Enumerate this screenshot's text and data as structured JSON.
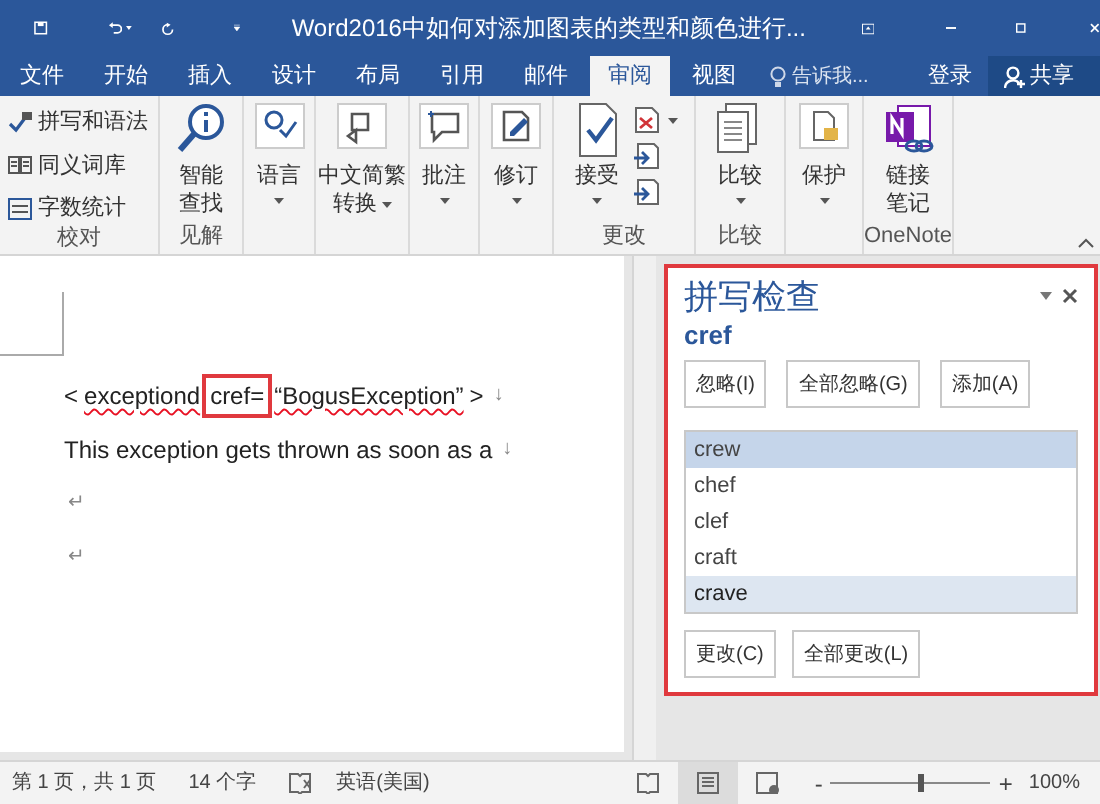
{
  "title_bar": {
    "title": "Word2016中如何对添加图表的类型和颜色进行..."
  },
  "tabs": [
    {
      "label": "文件",
      "selected": false
    },
    {
      "label": "开始",
      "selected": false
    },
    {
      "label": "插入",
      "selected": false
    },
    {
      "label": "设计",
      "selected": false
    },
    {
      "label": "布局",
      "selected": false
    },
    {
      "label": "引用",
      "selected": false
    },
    {
      "label": "邮件",
      "selected": false
    },
    {
      "label": "审阅",
      "selected": true
    },
    {
      "label": "视图",
      "selected": false
    }
  ],
  "tell_me": {
    "placeholder": "告诉我..."
  },
  "sign_in": "登录",
  "share": "共享",
  "ribbon": {
    "groups": [
      {
        "label": "校对",
        "buttons": [
          {
            "kind": "small",
            "label": "拼写和语法"
          },
          {
            "kind": "small",
            "label": "同义词库"
          },
          {
            "kind": "small",
            "label": "字数统计"
          }
        ]
      },
      {
        "label": "见解",
        "buttons": [
          {
            "kind": "large",
            "lines": [
              "智能",
              "查找"
            ],
            "dropdown": false
          }
        ]
      },
      {
        "buttons": [
          {
            "kind": "large",
            "lines": [
              "语言"
            ],
            "dropdown": true
          }
        ]
      },
      {
        "buttons": [
          {
            "kind": "large",
            "lines": [
              "中文简繁",
              "转换"
            ],
            "dropdown": true
          }
        ]
      },
      {
        "buttons": [
          {
            "kind": "large",
            "lines": [
              "批注"
            ],
            "dropdown": true
          }
        ]
      },
      {
        "buttons": [
          {
            "kind": "large",
            "lines": [
              "修订"
            ],
            "dropdown": true
          }
        ]
      },
      {
        "label": "更改",
        "buttons": [
          {
            "kind": "large",
            "lines": [
              "接受"
            ],
            "dropdown": true
          },
          {
            "kind": "stack"
          }
        ]
      },
      {
        "label": "比较",
        "buttons": [
          {
            "kind": "large",
            "lines": [
              "比较"
            ],
            "dropdown": true
          }
        ]
      },
      {
        "buttons": [
          {
            "kind": "large",
            "lines": [
              "保护"
            ],
            "dropdown": true
          }
        ]
      },
      {
        "label": "OneNote",
        "buttons": [
          {
            "kind": "large",
            "lines": [
              "链接",
              "笔记"
            ],
            "dropdown": false
          }
        ]
      }
    ]
  },
  "document": {
    "lines": [
      {
        "segments": [
          {
            "text": "<",
            "kind": "text"
          },
          {
            "text": "exceptiond",
            "kind": "misspelled"
          },
          {
            "text": "cref=",
            "kind": "boxed"
          },
          {
            "text": "“BogusException”",
            "kind": "misspelled"
          },
          {
            "text": ">",
            "kind": "text"
          },
          {
            "text": "↓",
            "kind": "mark"
          }
        ]
      },
      {
        "segments": [
          {
            "text": "This exception gets thrown as soon as a",
            "kind": "text"
          },
          {
            "text": "↓",
            "kind": "mark"
          }
        ]
      },
      {
        "segments": [
          {
            "text": "↵",
            "kind": "mark"
          }
        ]
      },
      {
        "segments": [
          {
            "text": "↵",
            "kind": "mark"
          }
        ]
      }
    ]
  },
  "spelling_pane": {
    "title": "拼写检查",
    "word": "cref",
    "highlighted": true,
    "buttons": [
      "忽略(I)",
      "全部忽略(G)",
      "添加(A)"
    ],
    "suggestions": [
      {
        "text": "crew",
        "selected": true,
        "hovered": false
      },
      {
        "text": "chef",
        "selected": false,
        "hovered": false
      },
      {
        "text": "clef",
        "selected": false,
        "hovered": false
      },
      {
        "text": "craft",
        "selected": false,
        "hovered": false
      },
      {
        "text": "crave",
        "selected": false,
        "hovered": true
      }
    ],
    "change_buttons": [
      "更改(C)",
      "全部更改(L)"
    ]
  },
  "status_bar": {
    "page": "第 1 页，共 1 页",
    "words": "14 个字",
    "language": "英语(美国)",
    "views": [
      {
        "selected": false
      },
      {
        "selected": true
      },
      {
        "selected": false
      }
    ],
    "zoom": {
      "out": "-",
      "in": "+",
      "level": 0.55,
      "reading": "100%"
    }
  }
}
